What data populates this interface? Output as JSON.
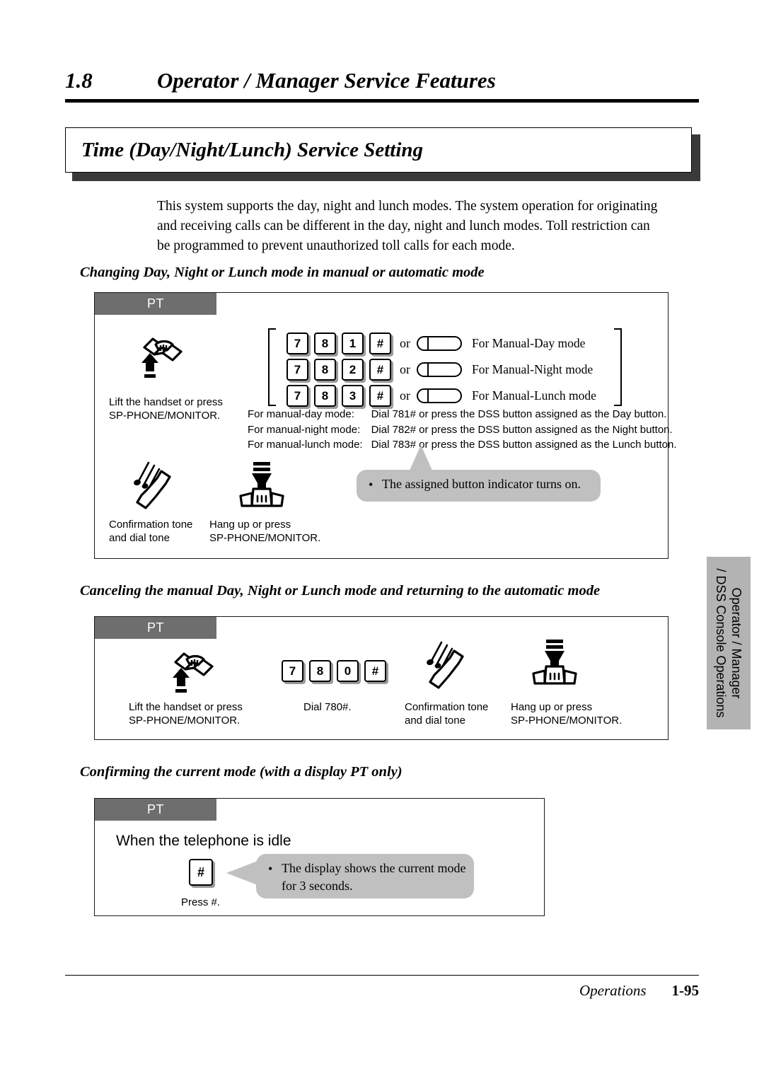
{
  "header": {
    "chapter_number": "1.8",
    "chapter_title": "Operator / Manager Service Features",
    "feature_title": "Time (Day/Night/Lunch) Service Setting"
  },
  "intro": "This system supports the day, night and lunch modes. The system operation for originating and receiving calls can be different in the day, night and lunch modes. Toll restriction can be programmed to prevent unauthorized toll calls for each mode.",
  "sections": [
    {
      "heading": "Changing Day, Night or Lunch mode in manual or automatic mode"
    },
    {
      "heading": "Canceling the manual Day, Night or Lunch mode and returning to the automatic mode"
    },
    {
      "heading": "Confirming the current mode (with a display PT only)"
    }
  ],
  "diagram1": {
    "pt_label": "PT",
    "key_rows": [
      {
        "keys": [
          "7",
          "8",
          "1",
          "#"
        ],
        "or": "or",
        "mode": "For Manual-Day mode"
      },
      {
        "keys": [
          "7",
          "8",
          "2",
          "#"
        ],
        "or": "or",
        "mode": "For Manual-Night mode"
      },
      {
        "keys": [
          "7",
          "8",
          "3",
          "#"
        ],
        "or": "or",
        "mode": "For Manual-Lunch mode"
      }
    ],
    "lift_caption": "Lift the handset or press\nSP-PHONE/MONITOR.",
    "instructions": [
      {
        "label": "For manual-day mode:",
        "text": "Dial 781# or press the DSS button assigned as the Day button."
      },
      {
        "label": "For manual-night mode:",
        "text": "Dial 782# or press the DSS button assigned as the Night button."
      },
      {
        "label": "For manual-lunch mode:",
        "text": "Dial 783# or press the DSS button assigned as the Lunch button."
      }
    ],
    "tone_caption": "Confirmation tone\nand dial tone",
    "hangup_caption": "Hang up or press\nSP-PHONE/MONITOR.",
    "callout_bullet": "•",
    "callout_text": "The assigned button indicator turns on."
  },
  "diagram2": {
    "pt_label": "PT",
    "lift_caption": "Lift the handset or press\nSP-PHONE/MONITOR.",
    "keys": [
      "7",
      "8",
      "0",
      "#"
    ],
    "dial_caption": "Dial 780#.",
    "tone_caption": "Confirmation tone\nand dial tone",
    "hangup_caption": "Hang up or press\nSP-PHONE/MONITOR."
  },
  "diagram3": {
    "pt_label": "PT",
    "idle_text": "When the telephone is idle",
    "key": "#",
    "press_caption": "Press #.",
    "callout_bullet": "•",
    "callout_text": "The display shows the current mode for 3 seconds."
  },
  "side_tab": {
    "line1": "Operator / Manager",
    "line2": "/ DSS Console Operations"
  },
  "footer": {
    "label": "Operations",
    "page": "1-95"
  },
  "colors": {
    "pt_tab_bg": "#6e6e6e",
    "callout_bg": "#c0c0c0",
    "side_tab_bg": "#b3b3b3",
    "title_shadow": "#3a3a3a"
  }
}
